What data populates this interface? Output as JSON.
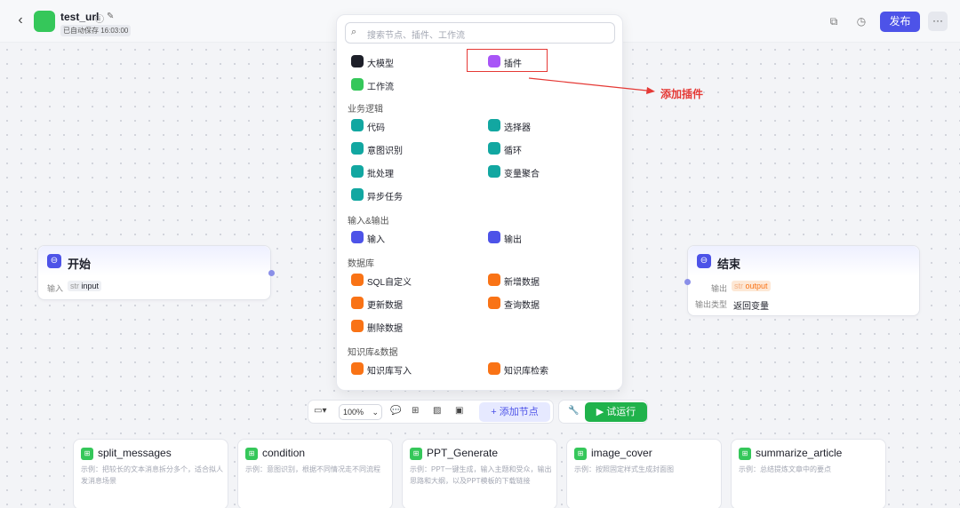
{
  "header": {
    "back_icon": "‹",
    "app_name": "test_url",
    "info_icon": "ⓘ",
    "edit_icon": "✎",
    "saved_status": "已自动保存 16:03:00",
    "publish_label": "发布",
    "more_label": "···"
  },
  "start_node": {
    "title": "开始",
    "input_label": "输入",
    "input_type": "str",
    "input_name": "input"
  },
  "end_node": {
    "title": "结束",
    "output_label": "输出",
    "output_type": "str",
    "output_name": "output",
    "output_kind_label": "输出类型",
    "output_kind_value": "返回变量"
  },
  "panel": {
    "search_placeholder": "搜索节点、插件、工作流",
    "top_items": [
      {
        "label": "大模型",
        "color": "#1d1f29"
      },
      {
        "label": "插件",
        "color": "#a855f7"
      },
      {
        "label": "工作流",
        "color": "#35c75a"
      }
    ],
    "sections": [
      {
        "title": "业务逻辑",
        "items": [
          {
            "label": "代码",
            "color": "#12a7a1"
          },
          {
            "label": "选择器",
            "color": "#12a7a1"
          },
          {
            "label": "意图识别",
            "color": "#12a7a1"
          },
          {
            "label": "循环",
            "color": "#12a7a1"
          },
          {
            "label": "批处理",
            "color": "#12a7a1"
          },
          {
            "label": "变量聚合",
            "color": "#12a7a1"
          },
          {
            "label": "异步任务",
            "color": "#12a7a1"
          }
        ]
      },
      {
        "title": "输入&输出",
        "items": [
          {
            "label": "输入",
            "color": "#4d53e8"
          },
          {
            "label": "输出",
            "color": "#4d53e8"
          }
        ]
      },
      {
        "title": "数据库",
        "items": [
          {
            "label": "SQL自定义",
            "color": "#f97316"
          },
          {
            "label": "新增数据",
            "color": "#f97316"
          },
          {
            "label": "更新数据",
            "color": "#f97316"
          },
          {
            "label": "查询数据",
            "color": "#f97316"
          },
          {
            "label": "删除数据",
            "color": "#f97316"
          }
        ]
      },
      {
        "title": "知识库&数据",
        "items": [
          {
            "label": "知识库写入",
            "color": "#f97316"
          },
          {
            "label": "知识库检索",
            "color": "#f97316"
          }
        ]
      }
    ]
  },
  "annotation": {
    "text": "添加插件",
    "color": "#e53935"
  },
  "toolbar": {
    "zoom": "100%",
    "add_node_label": "添加节点",
    "run_label": "试运行"
  },
  "cards": [
    {
      "title": "split_messages",
      "desc": "示例：把较长的文本消息拆分多个，适合拟人发消息场景"
    },
    {
      "title": "condition",
      "desc": "示例：意图识别，根据不同情况走不同流程"
    },
    {
      "title": "PPT_Generate",
      "desc": "示例：PPT一键生成，输入主题和受众，输出思路和大纲，以及PPT模板的下载链接"
    },
    {
      "title": "image_cover",
      "desc": "示例：按照固定样式生成封面图"
    },
    {
      "title": "summarize_article",
      "desc": "示例：总结提炼文章中的要点"
    }
  ]
}
